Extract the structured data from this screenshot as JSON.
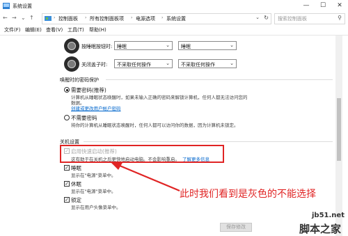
{
  "window": {
    "title": "系统设置",
    "icons": [
      "app-icon",
      "minimize-icon",
      "maximize-icon",
      "close-icon"
    ]
  },
  "address": {
    "crumbs": [
      "控制面板",
      "所有控制面板项",
      "电源选项",
      "系统设置"
    ],
    "search_placeholder": "搜索控制面板"
  },
  "menu": {
    "items": [
      "文件(F)",
      "编辑(E)",
      "查看(V)",
      "工具(T)",
      "帮助(H)"
    ]
  },
  "power_rows": [
    {
      "label": "按睡眠按钮时:",
      "icon": "sleep-button-icon",
      "battery_value": "睡眠",
      "plugged_value": "睡眠"
    },
    {
      "label": "关闭盖子时:",
      "icon": "lid-close-icon",
      "battery_value": "不采取任何操作",
      "plugged_value": "不采取任何操作"
    }
  ],
  "password": {
    "section_title": "唤醒时的密码保护",
    "require": {
      "title": "需要密码(推荐)",
      "desc1": "计算机从睡眠状态唤醒时，如果未输入正确的密码来解锁计算机，任何人都无法访问您的",
      "desc2": "数据。",
      "link": "创建或更改用户帐户密码"
    },
    "no_require": {
      "title": "不需要密码",
      "desc": "将你的计算机从睡眠状态唤醒时，任何人都可以访问你的数据，因为计算机未锁定。"
    }
  },
  "shutdown": {
    "section_title": "关机设置",
    "fast_startup": {
      "title": "启用快速启动(推荐)",
      "desc": "这有助于在关机之后更快地启动电脑。不会影响重启。",
      "link": "了解更多信息"
    },
    "sleep": {
      "title": "睡眠",
      "desc": "显示在\"电源\"菜单中。"
    },
    "hibernate": {
      "title": "休眠",
      "desc": "显示在\"电源\"菜单中。"
    },
    "lock": {
      "title": "锁定",
      "desc": "显示在用户头像菜单中。"
    }
  },
  "annotation": "此时我们看到是灰色的不能选择",
  "save_button": "保存修改",
  "watermark": {
    "line1": "jb51.net",
    "line2": "脚本之家"
  },
  "colors": {
    "accent_link": "#0066cc",
    "annotation_red": "#e02424"
  }
}
